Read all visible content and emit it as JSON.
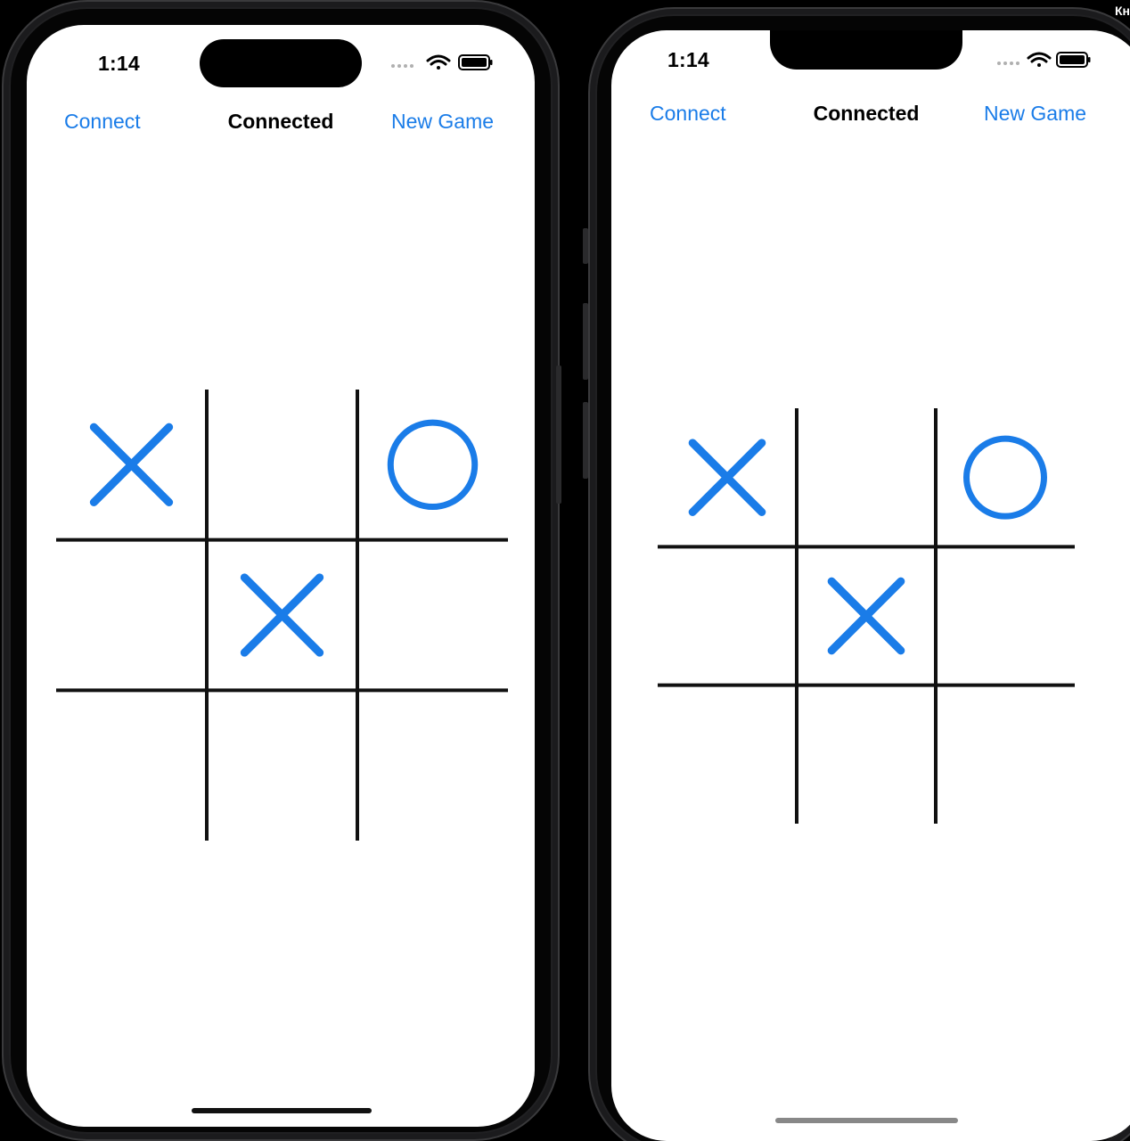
{
  "devices": [
    {
      "status": {
        "time": "1:14"
      },
      "nav": {
        "left": "Connect",
        "title": "Connected",
        "right": "New Game"
      },
      "board": [
        "X",
        "",
        "O",
        "",
        "X",
        "",
        "",
        "",
        ""
      ]
    },
    {
      "status": {
        "time": "1:14"
      },
      "nav": {
        "left": "Connect",
        "title": "Connected",
        "right": "New Game"
      },
      "board": [
        "X",
        "",
        "O",
        "",
        "X",
        "",
        "",
        "",
        ""
      ]
    }
  ],
  "corner_label": "Кн",
  "colors": {
    "accent": "#1a7ce8",
    "grid": "#111111",
    "background": "#000000"
  },
  "icons": [
    "signal-dots-icon",
    "wifi-icon",
    "battery-icon"
  ]
}
